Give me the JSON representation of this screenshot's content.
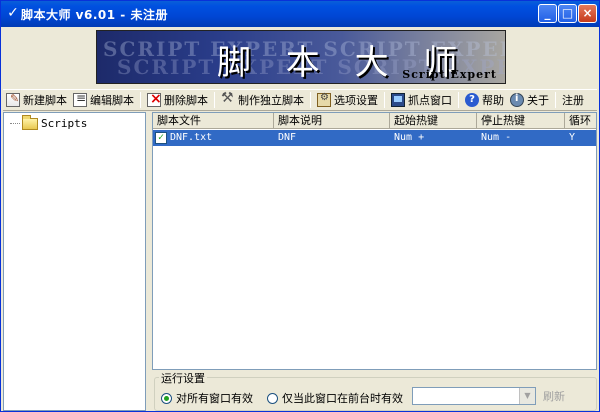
{
  "window": {
    "title": "脚本大师 v6.01 - 未注册",
    "icon": "checkmark-icon",
    "controls": {
      "minimize": "_",
      "maximize": "□",
      "close": "×"
    }
  },
  "banner": {
    "cn_title": "脚 本 大 师",
    "en_title": "Script Expert",
    "ghost_line1": "SCRIPT EXPERT SCRIPT EXPERT",
    "ghost_line2": "SCRIPT EXPERT SCRIPT EXPERT"
  },
  "toolbar": {
    "new_script": "新建脚本",
    "edit_script": "编辑脚本",
    "delete_script": "删除脚本",
    "make_standalone": "制作独立脚本",
    "options": "选项设置",
    "capture_window": "抓点窗口",
    "help": "帮助",
    "about": "关于",
    "register": "注册"
  },
  "tree": {
    "root_label": "Scripts"
  },
  "list": {
    "columns": [
      "脚本文件",
      "脚本说明",
      "起始热键",
      "停止热键",
      "循环"
    ],
    "rows": [
      {
        "checked": true,
        "file": "DNF.txt",
        "desc": "DNF",
        "start_hotkey": "Num +",
        "stop_hotkey": "Num -",
        "loop": "Y"
      }
    ]
  },
  "run_settings": {
    "title": "运行设置",
    "option_all": "对所有窗口有效",
    "option_foreground": "仅当此窗口在前台时有效",
    "selected": "option_all",
    "window_select_value": "",
    "refresh_label": "刷新"
  },
  "colors": {
    "title_bar": "#0050e0",
    "selection": "#316ac5",
    "face": "#ece9d8"
  }
}
